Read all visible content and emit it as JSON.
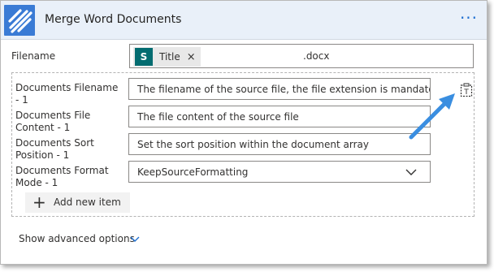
{
  "header": {
    "title": "Merge Word Documents",
    "more_symbol": "···",
    "icon": "striped-connector-icon",
    "icon_color": "#3a7bd5"
  },
  "filename": {
    "label": "Filename",
    "token": {
      "icon": "sharepoint-icon",
      "icon_letter": "S",
      "text": "Title",
      "remove": "×"
    },
    "suffix": ".docx"
  },
  "items": {
    "filename_label": "Documents Filename - 1",
    "filename_placeholder": "The filename of the source file, the file extension is mandatory: 'file",
    "content_label": "Documents File Content - 1",
    "content_placeholder": "The file content of the source file",
    "sort_label": "Documents Sort Position - 1",
    "sort_placeholder": "Set the sort position within the document array",
    "format_label": "Documents Format Mode - 1",
    "format_value": "KeepSourceFormatting",
    "add_label": "Add new item"
  },
  "advanced": {
    "label": "Show advanced options"
  },
  "colors": {
    "accent": "#1f6fd1",
    "arrow": "#3a8ee0",
    "header_bg": "#e9f0f9"
  }
}
